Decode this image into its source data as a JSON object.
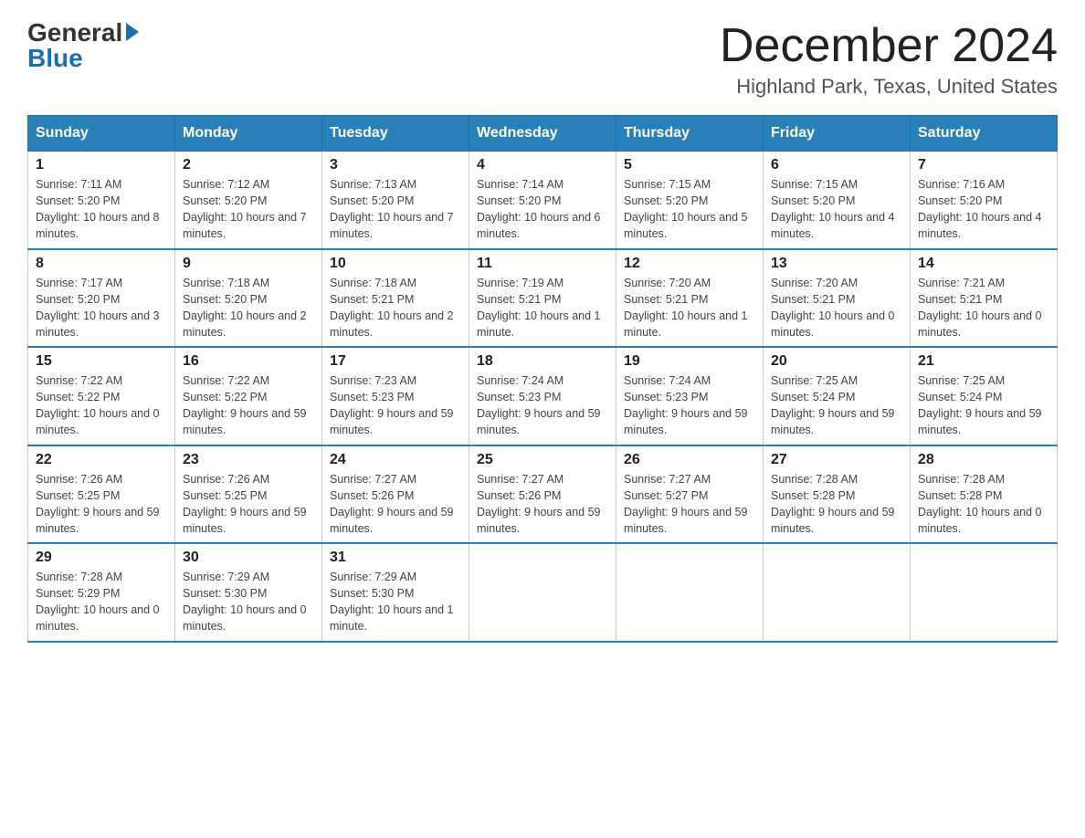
{
  "header": {
    "logo_general": "General",
    "logo_blue": "Blue",
    "month_title": "December 2024",
    "location": "Highland Park, Texas, United States"
  },
  "days_of_week": [
    "Sunday",
    "Monday",
    "Tuesday",
    "Wednesday",
    "Thursday",
    "Friday",
    "Saturday"
  ],
  "weeks": [
    [
      {
        "day": "1",
        "sunrise": "7:11 AM",
        "sunset": "5:20 PM",
        "daylight": "10 hours and 8 minutes."
      },
      {
        "day": "2",
        "sunrise": "7:12 AM",
        "sunset": "5:20 PM",
        "daylight": "10 hours and 7 minutes."
      },
      {
        "day": "3",
        "sunrise": "7:13 AM",
        "sunset": "5:20 PM",
        "daylight": "10 hours and 7 minutes."
      },
      {
        "day": "4",
        "sunrise": "7:14 AM",
        "sunset": "5:20 PM",
        "daylight": "10 hours and 6 minutes."
      },
      {
        "day": "5",
        "sunrise": "7:15 AM",
        "sunset": "5:20 PM",
        "daylight": "10 hours and 5 minutes."
      },
      {
        "day": "6",
        "sunrise": "7:15 AM",
        "sunset": "5:20 PM",
        "daylight": "10 hours and 4 minutes."
      },
      {
        "day": "7",
        "sunrise": "7:16 AM",
        "sunset": "5:20 PM",
        "daylight": "10 hours and 4 minutes."
      }
    ],
    [
      {
        "day": "8",
        "sunrise": "7:17 AM",
        "sunset": "5:20 PM",
        "daylight": "10 hours and 3 minutes."
      },
      {
        "day": "9",
        "sunrise": "7:18 AM",
        "sunset": "5:20 PM",
        "daylight": "10 hours and 2 minutes."
      },
      {
        "day": "10",
        "sunrise": "7:18 AM",
        "sunset": "5:21 PM",
        "daylight": "10 hours and 2 minutes."
      },
      {
        "day": "11",
        "sunrise": "7:19 AM",
        "sunset": "5:21 PM",
        "daylight": "10 hours and 1 minute."
      },
      {
        "day": "12",
        "sunrise": "7:20 AM",
        "sunset": "5:21 PM",
        "daylight": "10 hours and 1 minute."
      },
      {
        "day": "13",
        "sunrise": "7:20 AM",
        "sunset": "5:21 PM",
        "daylight": "10 hours and 0 minutes."
      },
      {
        "day": "14",
        "sunrise": "7:21 AM",
        "sunset": "5:21 PM",
        "daylight": "10 hours and 0 minutes."
      }
    ],
    [
      {
        "day": "15",
        "sunrise": "7:22 AM",
        "sunset": "5:22 PM",
        "daylight": "10 hours and 0 minutes."
      },
      {
        "day": "16",
        "sunrise": "7:22 AM",
        "sunset": "5:22 PM",
        "daylight": "9 hours and 59 minutes."
      },
      {
        "day": "17",
        "sunrise": "7:23 AM",
        "sunset": "5:23 PM",
        "daylight": "9 hours and 59 minutes."
      },
      {
        "day": "18",
        "sunrise": "7:24 AM",
        "sunset": "5:23 PM",
        "daylight": "9 hours and 59 minutes."
      },
      {
        "day": "19",
        "sunrise": "7:24 AM",
        "sunset": "5:23 PM",
        "daylight": "9 hours and 59 minutes."
      },
      {
        "day": "20",
        "sunrise": "7:25 AM",
        "sunset": "5:24 PM",
        "daylight": "9 hours and 59 minutes."
      },
      {
        "day": "21",
        "sunrise": "7:25 AM",
        "sunset": "5:24 PM",
        "daylight": "9 hours and 59 minutes."
      }
    ],
    [
      {
        "day": "22",
        "sunrise": "7:26 AM",
        "sunset": "5:25 PM",
        "daylight": "9 hours and 59 minutes."
      },
      {
        "day": "23",
        "sunrise": "7:26 AM",
        "sunset": "5:25 PM",
        "daylight": "9 hours and 59 minutes."
      },
      {
        "day": "24",
        "sunrise": "7:27 AM",
        "sunset": "5:26 PM",
        "daylight": "9 hours and 59 minutes."
      },
      {
        "day": "25",
        "sunrise": "7:27 AM",
        "sunset": "5:26 PM",
        "daylight": "9 hours and 59 minutes."
      },
      {
        "day": "26",
        "sunrise": "7:27 AM",
        "sunset": "5:27 PM",
        "daylight": "9 hours and 59 minutes."
      },
      {
        "day": "27",
        "sunrise": "7:28 AM",
        "sunset": "5:28 PM",
        "daylight": "9 hours and 59 minutes."
      },
      {
        "day": "28",
        "sunrise": "7:28 AM",
        "sunset": "5:28 PM",
        "daylight": "10 hours and 0 minutes."
      }
    ],
    [
      {
        "day": "29",
        "sunrise": "7:28 AM",
        "sunset": "5:29 PM",
        "daylight": "10 hours and 0 minutes."
      },
      {
        "day": "30",
        "sunrise": "7:29 AM",
        "sunset": "5:30 PM",
        "daylight": "10 hours and 0 minutes."
      },
      {
        "day": "31",
        "sunrise": "7:29 AM",
        "sunset": "5:30 PM",
        "daylight": "10 hours and 1 minute."
      },
      null,
      null,
      null,
      null
    ]
  ],
  "labels": {
    "sunrise_prefix": "Sunrise: ",
    "sunset_prefix": "Sunset: ",
    "daylight_prefix": "Daylight: "
  }
}
